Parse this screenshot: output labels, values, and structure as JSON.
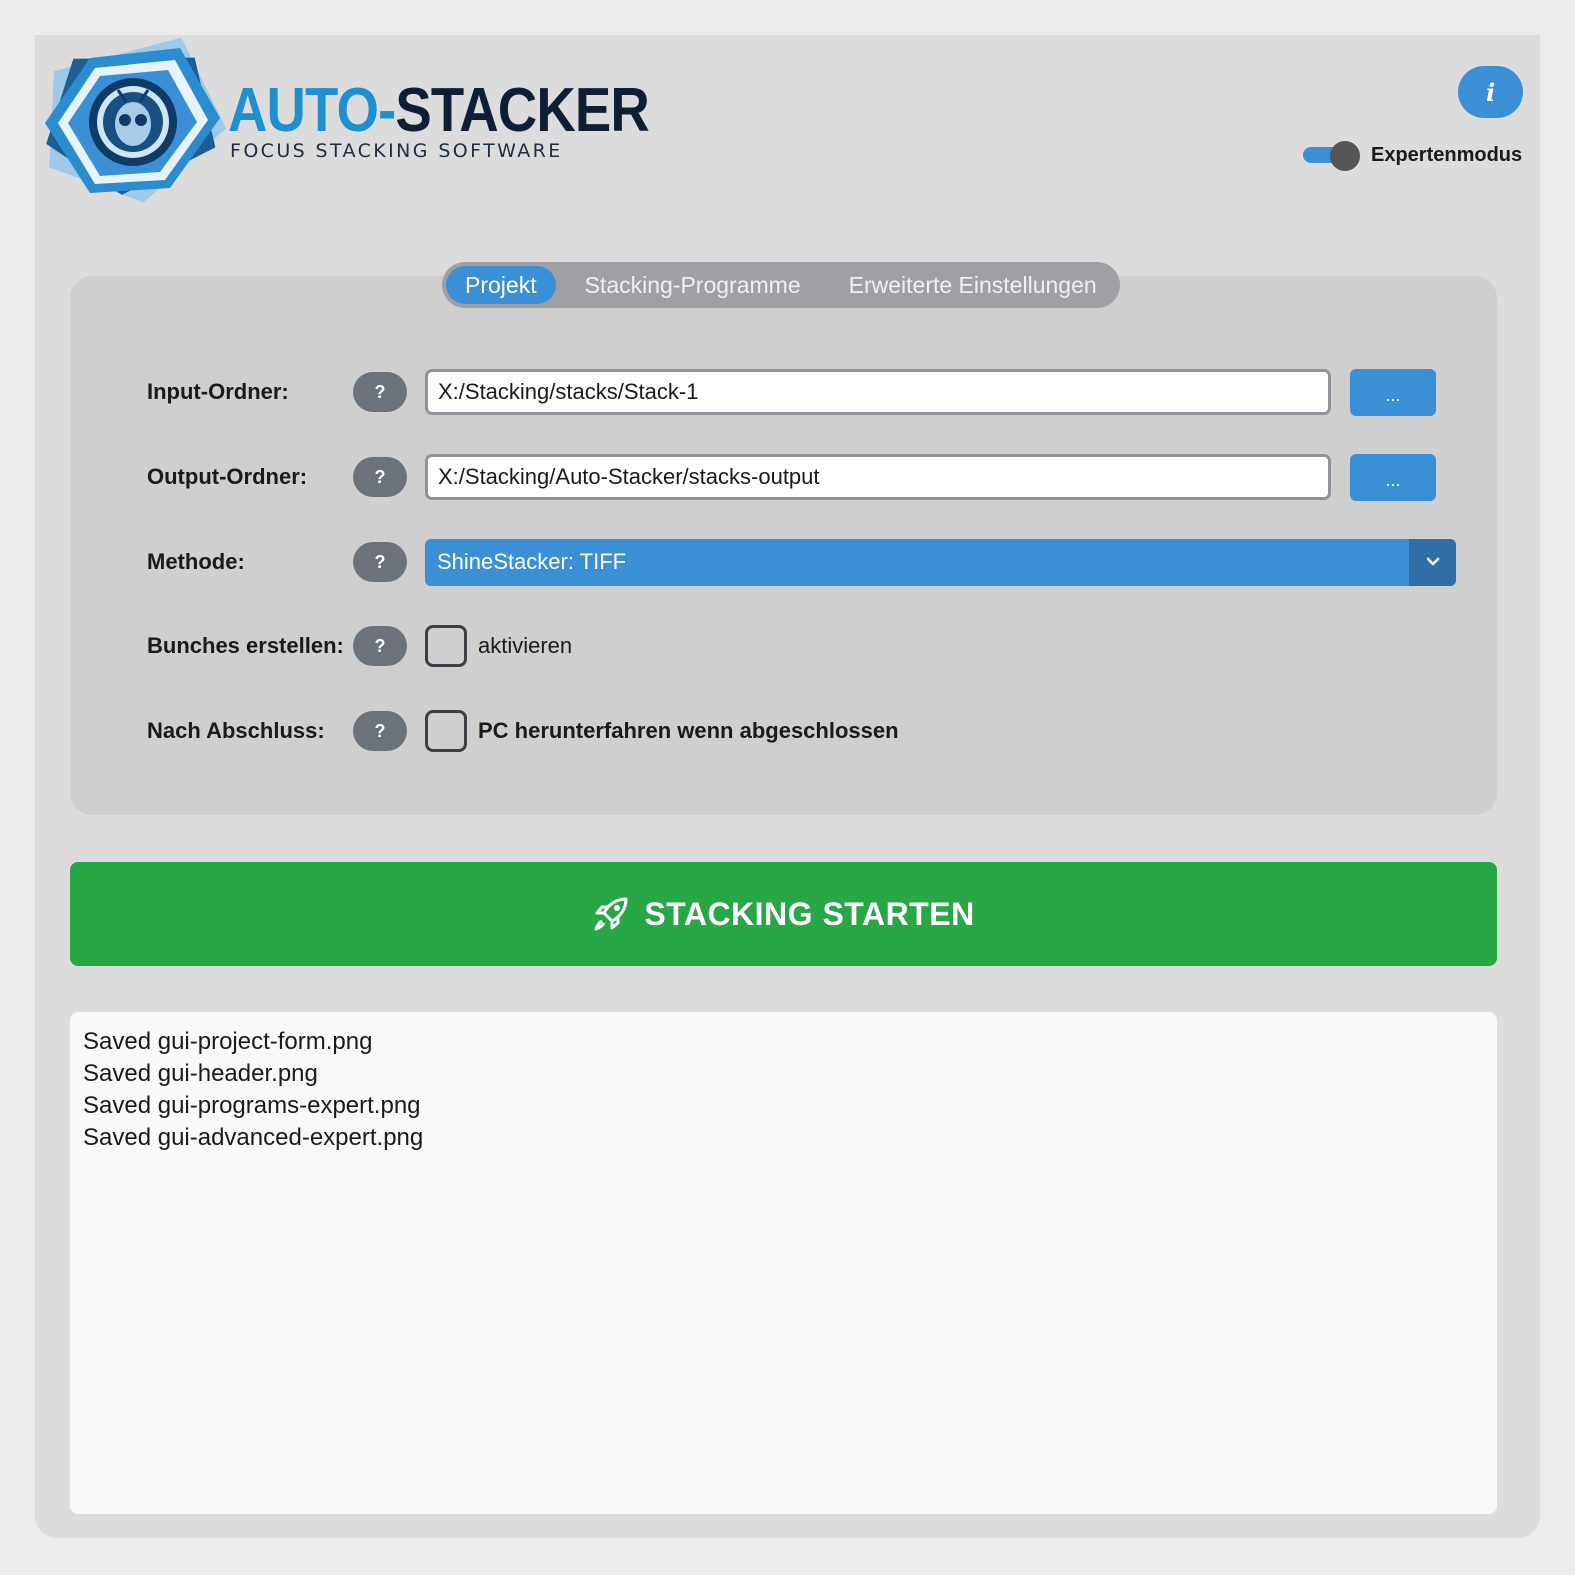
{
  "brand": {
    "title_part1": "AUTO-",
    "title_part2": "STACKER",
    "subtitle": "FOCUS STACKING SOFTWARE"
  },
  "header": {
    "info_label": "i",
    "expert_mode_label": "Expertenmodus",
    "expert_mode_on": true
  },
  "tabs": [
    {
      "label": "Projekt",
      "active": true
    },
    {
      "label": "Stacking-Programme",
      "active": false
    },
    {
      "label": "Erweiterte Einstellungen",
      "active": false
    }
  ],
  "form": {
    "help_label": "?",
    "browse_label": "...",
    "input_folder": {
      "label": "Input-Ordner:",
      "value": "X:/Stacking/stacks/Stack-1"
    },
    "output_folder": {
      "label": "Output-Ordner:",
      "value": "X:/Stacking/Auto-Stacker/stacks-output"
    },
    "method": {
      "label": "Methode:",
      "value": "ShineStacker: TIFF"
    },
    "bunches": {
      "label": "Bunches erstellen:",
      "checkbox_label": "aktivieren",
      "checked": false
    },
    "after": {
      "label": "Nach Abschluss:",
      "checkbox_label": "PC herunterfahren wenn abgeschlossen",
      "checked": false
    }
  },
  "start_button": {
    "label": "STACKING STARTEN",
    "icon": "rocket-icon"
  },
  "log": {
    "lines": [
      "Saved gui-project-form.png",
      "Saved gui-header.png",
      "Saved gui-programs-expert.png",
      "Saved gui-advanced-expert.png"
    ]
  },
  "colors": {
    "accent": "#3b8fd4",
    "start": "#27a745",
    "help": "#6b7279"
  }
}
